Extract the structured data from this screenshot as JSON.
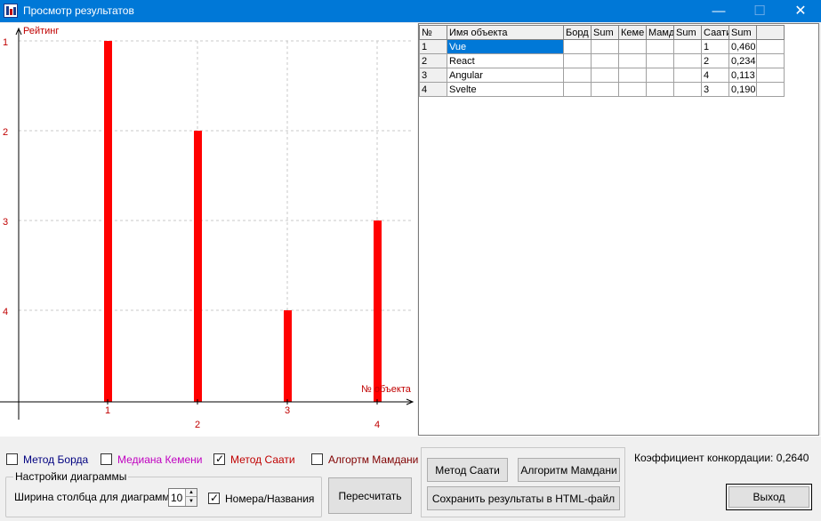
{
  "window": {
    "title": "Просмотр результатов",
    "controls": {
      "minimize": "—",
      "maximize": "☐",
      "close": "✕"
    }
  },
  "chart_data": {
    "type": "bar",
    "ylabel": "Рейтинг",
    "xlabel": "№ объекта",
    "y_ticks": [
      "1",
      "2",
      "3",
      "4"
    ],
    "y_inverted": true,
    "ylim": [
      0,
      4
    ],
    "categories": [
      "1",
      "2",
      "3",
      "4"
    ],
    "values": [
      1,
      2,
      4,
      3
    ],
    "bar_color": "#ff0000",
    "grid": true,
    "gridline_color": "#c8c8c8"
  },
  "grid": {
    "headers": [
      "№",
      "Имя объекта",
      "Борд",
      "Sum",
      "Кеме",
      "Мамд",
      "Sum",
      "Саати",
      "Sum",
      ""
    ],
    "rows": [
      [
        "1",
        "Vue",
        "",
        "",
        "",
        "",
        "",
        "1",
        "0,460",
        ""
      ],
      [
        "2",
        "React",
        "",
        "",
        "",
        "",
        "",
        "2",
        "0,234",
        ""
      ],
      [
        "3",
        "Angular",
        "",
        "",
        "",
        "",
        "",
        "4",
        "0,113",
        ""
      ],
      [
        "4",
        "Svelte",
        "",
        "",
        "",
        "",
        "",
        "3",
        "0,190",
        ""
      ]
    ]
  },
  "options": {
    "borda": {
      "label": "Метод Борда",
      "checked": false,
      "color": "#000080"
    },
    "kemeny": {
      "label": "Медиана Кемени",
      "checked": false,
      "color": "#c000c0"
    },
    "saaty": {
      "label": "Метод Саати",
      "checked": true,
      "color": "#c00000"
    },
    "mamdani": {
      "label": "Алгортм Мамдани",
      "checked": false,
      "color": "#800000"
    }
  },
  "settings": {
    "group_title": "Настройки диаграммы",
    "width_label": "Ширина столбца для диаграммы:",
    "width_value": "10",
    "names_label": "Номера/Названия",
    "names_checked": true
  },
  "buttons": {
    "recalc": "Пересчитать",
    "saaty": "Метод Саати",
    "mamdani": "Алгоритм Мамдани",
    "save_html": "Сохранить результаты в HTML-файл",
    "exit": "Выход"
  },
  "concordance": "Коэффициент конкордации: 0,2640"
}
